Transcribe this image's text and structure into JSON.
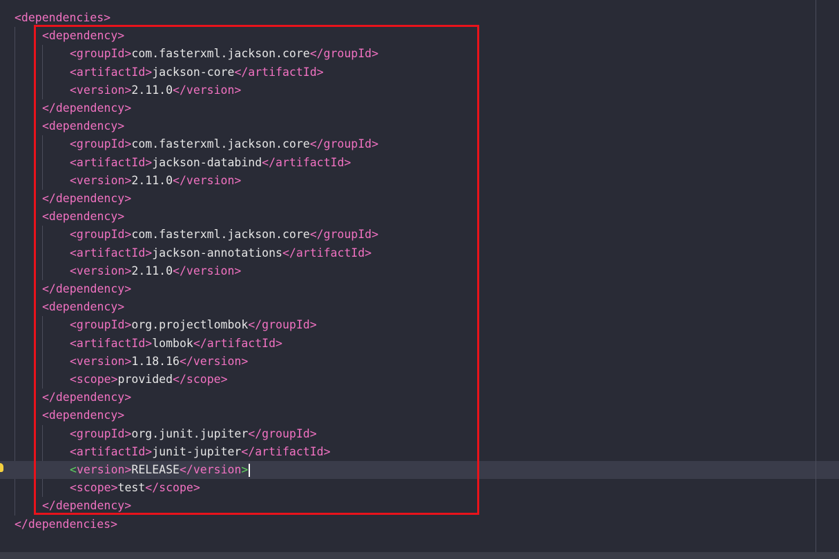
{
  "editor": {
    "lines": [
      {
        "indent": 0,
        "parts": [
          {
            "t": "tag",
            "v": "<dependencies>"
          }
        ]
      },
      {
        "indent": 1,
        "parts": [
          {
            "t": "tag",
            "v": "<dependency>"
          }
        ]
      },
      {
        "indent": 2,
        "parts": [
          {
            "t": "tag",
            "v": "<groupId>"
          },
          {
            "t": "txt",
            "v": "com.fasterxml.jackson.core"
          },
          {
            "t": "tag",
            "v": "</groupId>"
          }
        ]
      },
      {
        "indent": 2,
        "parts": [
          {
            "t": "tag",
            "v": "<artifactId>"
          },
          {
            "t": "txt",
            "v": "jackson-core"
          },
          {
            "t": "tag",
            "v": "</artifactId>"
          }
        ]
      },
      {
        "indent": 2,
        "parts": [
          {
            "t": "tag",
            "v": "<version>"
          },
          {
            "t": "txt",
            "v": "2.11.0"
          },
          {
            "t": "tag",
            "v": "</version>"
          }
        ]
      },
      {
        "indent": 1,
        "parts": [
          {
            "t": "tag",
            "v": "</dependency>"
          }
        ]
      },
      {
        "indent": 1,
        "parts": [
          {
            "t": "tag",
            "v": "<dependency>"
          }
        ]
      },
      {
        "indent": 2,
        "parts": [
          {
            "t": "tag",
            "v": "<groupId>"
          },
          {
            "t": "txt",
            "v": "com.fasterxml.jackson.core"
          },
          {
            "t": "tag",
            "v": "</groupId>"
          }
        ]
      },
      {
        "indent": 2,
        "parts": [
          {
            "t": "tag",
            "v": "<artifactId>"
          },
          {
            "t": "txt",
            "v": "jackson-databind"
          },
          {
            "t": "tag",
            "v": "</artifactId>"
          }
        ]
      },
      {
        "indent": 2,
        "parts": [
          {
            "t": "tag",
            "v": "<version>"
          },
          {
            "t": "txt",
            "v": "2.11.0"
          },
          {
            "t": "tag",
            "v": "</version>"
          }
        ]
      },
      {
        "indent": 1,
        "parts": [
          {
            "t": "tag",
            "v": "</dependency>"
          }
        ]
      },
      {
        "indent": 1,
        "parts": [
          {
            "t": "tag",
            "v": "<dependency>"
          }
        ]
      },
      {
        "indent": 2,
        "parts": [
          {
            "t": "tag",
            "v": "<groupId>"
          },
          {
            "t": "txt",
            "v": "com.fasterxml.jackson.core"
          },
          {
            "t": "tag",
            "v": "</groupId>"
          }
        ]
      },
      {
        "indent": 2,
        "parts": [
          {
            "t": "tag",
            "v": "<artifactId>"
          },
          {
            "t": "txt",
            "v": "jackson-annotations"
          },
          {
            "t": "tag",
            "v": "</artifactId>"
          }
        ]
      },
      {
        "indent": 2,
        "parts": [
          {
            "t": "tag",
            "v": "<version>"
          },
          {
            "t": "txt",
            "v": "2.11.0"
          },
          {
            "t": "tag",
            "v": "</version>"
          }
        ]
      },
      {
        "indent": 1,
        "parts": [
          {
            "t": "tag",
            "v": "</dependency>"
          }
        ]
      },
      {
        "indent": 1,
        "parts": [
          {
            "t": "tag",
            "v": "<dependency>"
          }
        ]
      },
      {
        "indent": 2,
        "parts": [
          {
            "t": "tag",
            "v": "<groupId>"
          },
          {
            "t": "txt",
            "v": "org.projectlombok"
          },
          {
            "t": "tag",
            "v": "</groupId>"
          }
        ]
      },
      {
        "indent": 2,
        "parts": [
          {
            "t": "tag",
            "v": "<artifactId>"
          },
          {
            "t": "txt",
            "v": "lombok"
          },
          {
            "t": "tag",
            "v": "</artifactId>"
          }
        ]
      },
      {
        "indent": 2,
        "parts": [
          {
            "t": "tag",
            "v": "<version>"
          },
          {
            "t": "txt",
            "v": "1.18.16"
          },
          {
            "t": "tag",
            "v": "</version>"
          }
        ]
      },
      {
        "indent": 2,
        "parts": [
          {
            "t": "tag",
            "v": "<scope>"
          },
          {
            "t": "txt",
            "v": "provided"
          },
          {
            "t": "tag",
            "v": "</scope>"
          }
        ]
      },
      {
        "indent": 1,
        "parts": [
          {
            "t": "tag",
            "v": "</dependency>"
          }
        ]
      },
      {
        "indent": 1,
        "parts": [
          {
            "t": "tag",
            "v": "<dependency>"
          }
        ]
      },
      {
        "indent": 2,
        "parts": [
          {
            "t": "tag",
            "v": "<groupId>"
          },
          {
            "t": "txt",
            "v": "org.junit.jupiter"
          },
          {
            "t": "tag",
            "v": "</groupId>"
          }
        ]
      },
      {
        "indent": 2,
        "parts": [
          {
            "t": "tag",
            "v": "<artifactId>"
          },
          {
            "t": "txt",
            "v": "junit-jupiter"
          },
          {
            "t": "tag",
            "v": "</artifactId>"
          }
        ]
      },
      {
        "indent": 2,
        "current": true,
        "parts": [
          {
            "t": "match",
            "v": "<"
          },
          {
            "t": "tag",
            "v": "version>"
          },
          {
            "t": "txt",
            "v": "RELEASE"
          },
          {
            "t": "tag",
            "v": "</version"
          },
          {
            "t": "match",
            "v": ">"
          }
        ]
      },
      {
        "indent": 2,
        "parts": [
          {
            "t": "tag",
            "v": "<scope>"
          },
          {
            "t": "txt",
            "v": "test"
          },
          {
            "t": "tag",
            "v": "</scope>"
          }
        ]
      },
      {
        "indent": 1,
        "parts": [
          {
            "t": "tag",
            "v": "</dependency>"
          }
        ]
      },
      {
        "indent": 0,
        "parts": [
          {
            "t": "tag",
            "v": "</dependencies>"
          }
        ]
      }
    ],
    "colors": {
      "background": "#292b36",
      "tag": "#f272c2",
      "text": "#e6e6e6",
      "bracket_match": "#5fd35f",
      "highlight_box": "#e8131b",
      "current_line": "#3a3c4a"
    },
    "icons": [
      "lightbulb-icon"
    ]
  }
}
